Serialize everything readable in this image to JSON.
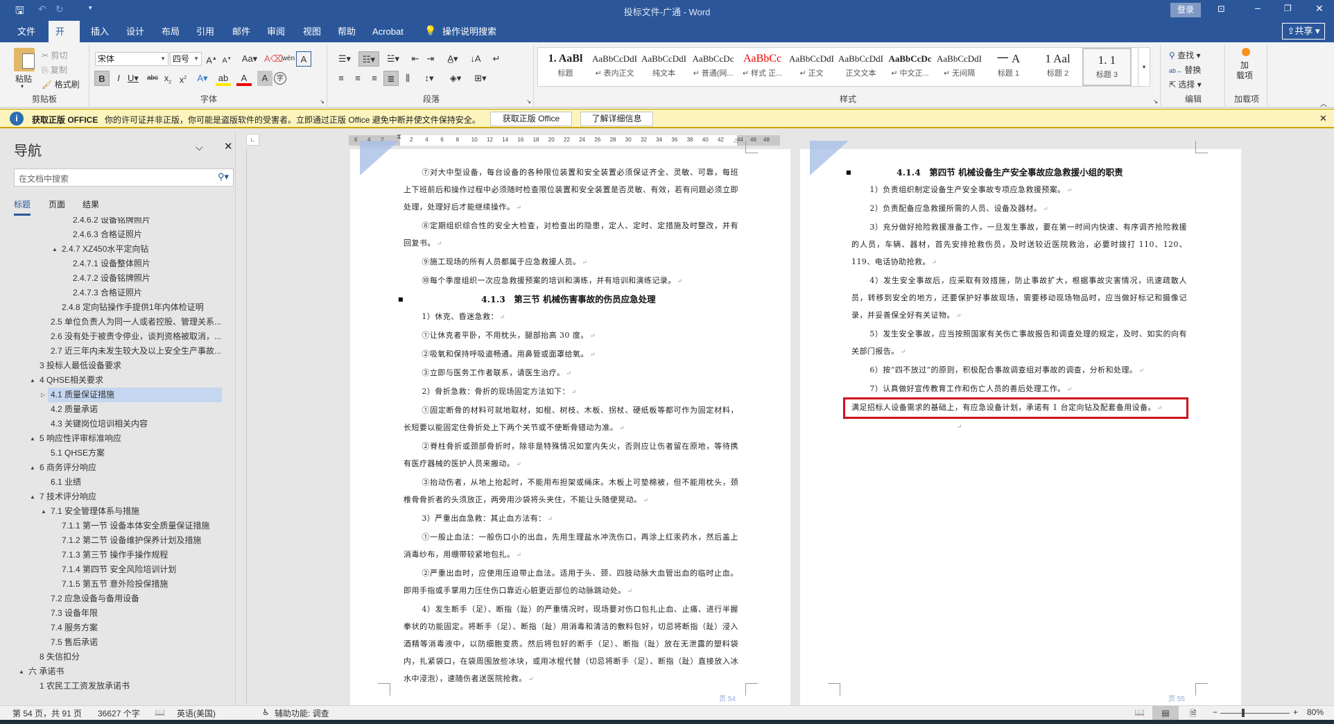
{
  "window": {
    "title": "投标文件-广通  -  Word",
    "login": "登录",
    "share": "共享"
  },
  "tabs": [
    "文件",
    "开始",
    "插入",
    "设计",
    "布局",
    "引用",
    "邮件",
    "审阅",
    "视图",
    "帮助",
    "Acrobat",
    "操作说明搜索"
  ],
  "ribbon": {
    "clipboard": {
      "label": "剪贴板",
      "paste": "粘贴",
      "cut": "剪切",
      "copy": "复制",
      "format_painter": "格式刷"
    },
    "font": {
      "label": "字体",
      "name": "宋体",
      "size": "四号"
    },
    "paragraph": {
      "label": "段落"
    },
    "styles": {
      "label": "样式",
      "items": [
        {
          "preview": "1. AaBl",
          "name": "标题"
        },
        {
          "preview": "AaBbCcDdI",
          "name": "↵ 表内正文"
        },
        {
          "preview": "AaBbCcDdI",
          "name": "纯文本"
        },
        {
          "preview": "AaBbCcDc",
          "name": "↵ 普通(网..."
        },
        {
          "preview": "AaBbCc",
          "name": "↵ 样式 正..."
        },
        {
          "preview": "AaBbCcDdI",
          "name": "↵ 正文"
        },
        {
          "preview": "AaBbCcDdI",
          "name": "正文文本"
        },
        {
          "preview": "AaBbCcDc",
          "name": "↵ 中文正..."
        },
        {
          "preview": "AaBbCcDdI",
          "name": "↵ 无间隔"
        },
        {
          "preview": "一  A",
          "name": "标题 1"
        },
        {
          "preview": "1  Aal",
          "name": "标题 2"
        },
        {
          "preview": "1. 1",
          "name": "标题 3"
        }
      ]
    },
    "editing": {
      "label": "编辑",
      "find": "查找",
      "replace": "替换",
      "select": "选择"
    },
    "addins": {
      "label": "加载项",
      "button": "加\n载项"
    }
  },
  "notice": {
    "title": "获取正版 OFFICE",
    "message": "你的许可证并非正版，你可能是盗版软件的受害者。立即通过正版 Office 避免中断并使文件保持安全。",
    "btn_get": "获取正版 Office",
    "btn_more": "了解详细信息"
  },
  "ruler": {
    "left_ticks": [
      "6",
      "4",
      "2"
    ],
    "ticks": [
      "2",
      "4",
      "6",
      "8",
      "10",
      "12",
      "14",
      "16",
      "18",
      "20",
      "22",
      "24",
      "26",
      "28",
      "30",
      "32",
      "34",
      "36",
      "38",
      "40",
      "42"
    ],
    "right_ticks": [
      "44",
      "46",
      "48"
    ]
  },
  "nav": {
    "title": "导航",
    "search_placeholder": "在文档中搜索",
    "tabs": [
      "标题",
      "页面",
      "结果"
    ],
    "items": [
      {
        "t": "2.4.6.2 设备铭牌照片",
        "l": 4
      },
      {
        "t": "2.4.6.3 合格证照片",
        "l": 4
      },
      {
        "t": "2.4.7 XZ450水平定向钻",
        "l": 3,
        "exp": "▲"
      },
      {
        "t": "2.4.7.1 设备整体照片",
        "l": 4
      },
      {
        "t": "2.4.7.2 设备铭牌照片",
        "l": 4
      },
      {
        "t": "2.4.7.3 合格证照片",
        "l": 4
      },
      {
        "t": "2.4.8 定向钻操作手提供1年内体检证明",
        "l": 3
      },
      {
        "t": "2.5 单位负责人为同一人或者控股、管理关系...",
        "l": 2
      },
      {
        "t": "2.6 没有处于被责令停业，谈判资格被取消，...",
        "l": 2
      },
      {
        "t": "2.7 近三年内未发生较大及以上安全生产事故...",
        "l": 2
      },
      {
        "t": "3 投标人最低设备要求",
        "l": 1
      },
      {
        "t": "4 QHSE相关要求",
        "l": 1,
        "exp": "▲"
      },
      {
        "t": "4.1 质量保证措施",
        "l": 2,
        "exp": "▷",
        "hl": true
      },
      {
        "t": "4.2 质量承诺",
        "l": 2
      },
      {
        "t": "4.3 关键岗位培训相关内容",
        "l": 2
      },
      {
        "t": "5 响应性评审标准响应",
        "l": 1,
        "exp": "▲"
      },
      {
        "t": "5.1 QHSE方案",
        "l": 2
      },
      {
        "t": "6 商务评分响应",
        "l": 1,
        "exp": "▲"
      },
      {
        "t": "6.1 业绩",
        "l": 2
      },
      {
        "t": "7 技术评分响应",
        "l": 1,
        "exp": "▲"
      },
      {
        "t": "7.1 安全管理体系与措施",
        "l": 2,
        "exp": "▲"
      },
      {
        "t": "7.1.1 第一节 设备本体安全质量保证措施",
        "l": 3
      },
      {
        "t": "7.1.2 第二节 设备维护保养计划及措施",
        "l": 3
      },
      {
        "t": "7.1.3 第三节 操作手操作规程",
        "l": 3
      },
      {
        "t": "7.1.4 第四节 安全风险培训计划",
        "l": 3
      },
      {
        "t": "7.1.5 第五节 意外险投保措施",
        "l": 3
      },
      {
        "t": "7.2 应急设备与备用设备",
        "l": 2
      },
      {
        "t": "7.3 设备年限",
        "l": 2
      },
      {
        "t": "7.4 服务方案",
        "l": 2
      },
      {
        "t": "7.5 售后承诺",
        "l": 2
      },
      {
        "t": "8 失信扣分",
        "l": 1
      },
      {
        "t": "六 承诺书",
        "l": 0,
        "exp": "▲"
      },
      {
        "t": "1 农民工工资发放承诺书",
        "l": 1
      }
    ]
  },
  "pages": [
    {
      "footer": "页 54",
      "blocks": [
        {
          "p": "⑦对大中型设备，每台设备的各种限位装置和安全装置必须保证齐全、灵敏、可靠，每班上下班前后和操作过程中必须随时检查限位装置和安全装置是否灵敏、有效，若有问题必须立即处理，处理好后才能继续操作。"
        },
        {
          "p": "⑧定期组织综合性的安全大检查，对检查出的隐患，定人、定时、定措施及时整改，并有回复书。"
        },
        {
          "p": "⑨施工现场的所有人员都属于应急救援人员。"
        },
        {
          "p": "⑩每个季度组织一次应急救援预案的培训和演练，并有培训和演练记录。"
        },
        {
          "h": "4.1.3　第三节 机械伤害事故的伤员应急处理"
        },
        {
          "p": "1）休克、昏迷急救："
        },
        {
          "p": "①让休克者平卧，不用枕头，腿部抬高 30 度。"
        },
        {
          "p": "②吸氧和保持呼吸道畅通。用鼻管或面罩给氧。"
        },
        {
          "p": "③立即与医务工作者联系，请医生治疗。"
        },
        {
          "p": "2）骨折急救：骨折的现场固定方法如下："
        },
        {
          "p": "①固定断骨的材料可就地取材，如棍、树枝、木板、拐杖、硬纸板等都可作为固定材料，长短要以能固定住骨折处上下两个关节或不使断骨错动为准。"
        },
        {
          "p": "②脊柱骨折或颈部骨折时，除非是特殊情况如室内失火，否则应让伤者留在原地，等待携有医疗器械的医护人员来搬动。"
        },
        {
          "p": "③抬动伤者，从地上抬起时，不能用布担架或绳床。木板上可垫棉被，但不能用枕头，颈椎骨骨折者的头须放正，两旁用沙袋将头夹住，不能让头随便晃动。"
        },
        {
          "p": "3）严重出血急救：其止血方法有："
        },
        {
          "p": "①一般止血法：一般伤口小的出血，先用生理盐水冲洗伤口，再涂上红汞药水，然后盖上消毒纱布，用绷带较紧地包扎。"
        },
        {
          "p": "②严重出血时，应使用压迫带止血法。适用于头、颈、四肢动脉大血管出血的临时止血。即用手指或手掌用力压住伤口靠近心脏更近部位的动脉跳动处。"
        },
        {
          "p": "4）发生断手（足）、断指（趾）的严重情况时，现场要对伤口包扎止血、止痛、进行半握拳状的功能固定。将断手（足）、断指（趾）用消毒和清洁的敷料包好，切忌将断指（趾）浸入酒精等消毒液中，以防细胞变质。然后将包好的断手（足）、断指（趾）放在无泄露的塑料袋内，扎紧袋口，在袋周围放些冰块，或用冰棍代替（切忌将断手（足）、断指（趾）直接放入冰水中浸泡），速随伤者送医院抢救。"
        }
      ]
    },
    {
      "footer": "页 55",
      "blocks": [
        {
          "h": "4.1.4　第四节 机械设备生产安全事故应急救援小组的职责"
        },
        {
          "p": "1）负责组织制定设备生产安全事故专项应急救援预案。"
        },
        {
          "p": "2）负责配备应急救援所需的人员、设备及器材。"
        },
        {
          "p": "3）充分做好抢险救援准备工作，一旦发生事故，要在第一时间内快速、有序调齐抢险救援的人员，车辆、器材，首先安排抢救伤员，及时送较近医院救治，必要时拨打 110、120、119、电话协助抢救。"
        },
        {
          "p": "4）发生安全事故后，应采取有效措施，防止事故扩大，根据事故灾害情况，讯速疏散人员，转移到安全的地方，还要保护好事故现场，需要移动现场物品时，应当做好标记和摄像记录，并妥善保全好有关证物。"
        },
        {
          "p": "5）发生安全事故，应当按照国家有关伤亡事故报告和调查处理的规定，及时、如实的向有关部门报告。"
        },
        {
          "p": "6）按“四不放过”的原则，积极配合事故调查组对事故的调查，分析和处理。"
        },
        {
          "p": "7）认真做好宣传教育工作和伤亡人员的善后处理工作。"
        },
        {
          "p": "满足招标人设备需求的基础上，有应急设备计划，承诺有 1 台定向钻及配套备用设备。",
          "boxed": true
        },
        {
          "p": ""
        }
      ]
    }
  ],
  "status": {
    "page": "第 54 页，共 91 页",
    "words": "36627 个字",
    "language": "英语(美国)",
    "accessibility": "辅助功能: 调查",
    "zoom": "80%",
    "zoom_value": 80
  },
  "colors": {
    "brand": "#2b579a",
    "notice_bg": "#fcf4bc",
    "highlight_box": "#d0121b"
  }
}
